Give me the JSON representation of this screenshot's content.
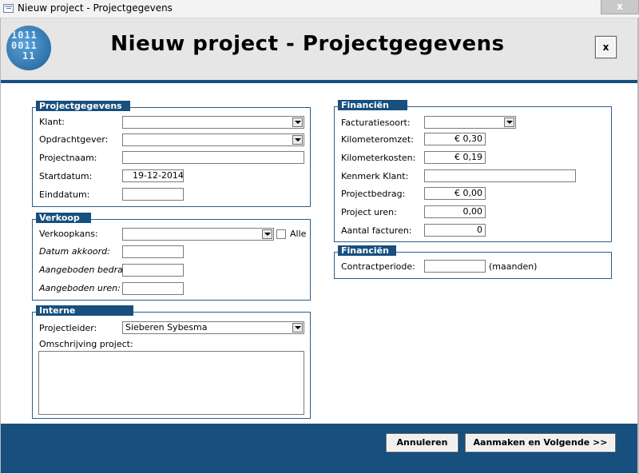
{
  "window": {
    "title": "Nieuw project - Projectgegevens",
    "close_glyph": "x"
  },
  "header": {
    "title": "Nieuw project - Projectgegevens",
    "close_label": "x",
    "logo_bits": [
      "1011",
      "0011",
      "11"
    ]
  },
  "projectgegevens": {
    "title": "Projectgegevens",
    "klant_label": "Klant:",
    "klant_value": "",
    "opdrachtgever_label": "Opdrachtgever:",
    "opdrachtgever_value": "",
    "projectnaam_label": "Projectnaam:",
    "projectnaam_value": "",
    "startdatum_label": "Startdatum:",
    "startdatum_value": "19-12-2014",
    "einddatum_label": "Einddatum:",
    "einddatum_value": ""
  },
  "verkoop": {
    "title": "Verkoop",
    "verkoopkans_label": "Verkoopkans:",
    "verkoopkans_value": "",
    "alle_label": "Alle",
    "datum_akkoord_label": "Datum akkoord:",
    "datum_akkoord_value": "",
    "aangeboden_bedrag_label": "Aangeboden bedra",
    "aangeboden_bedrag_value": "",
    "aangeboden_uren_label": "Aangeboden uren:",
    "aangeboden_uren_value": ""
  },
  "interne_organisatie": {
    "title": "Interne organisatie",
    "projectleider_label": "Projectleider:",
    "projectleider_value": "Sieberen Sybesma",
    "omschrijving_label": "Omschrijving project:",
    "omschrijving_value": ""
  },
  "financien": {
    "title": "Financiën",
    "facturatiesoort_label": "Facturatiesoort:",
    "facturatiesoort_value": "",
    "kilometeromzet_label": "Kilometeromzet:",
    "kilometeromzet_value": "€ 0,30",
    "kilometerkosten_label": "Kilometerkosten:",
    "kilometerkosten_value": "€ 0,19",
    "kenmerk_klant_label": "Kenmerk Klant:",
    "kenmerk_klant_value": "",
    "projectbedrag_label": "Projectbedrag:",
    "projectbedrag_value": "€ 0,00",
    "project_uren_label": "Project uren:",
    "project_uren_value": "0,00",
    "aantal_facturen_label": "Aantal facturen:",
    "aantal_facturen_value": "0"
  },
  "financien2": {
    "title": "Financiën",
    "contractperiode_label": "Contractperiode:",
    "contractperiode_value": "",
    "maanden_label": "(maanden)"
  },
  "footer": {
    "cancel_label": "Annuleren",
    "create_next_label": "Aanmaken en Volgende >>"
  },
  "colors": {
    "accent": "#174f7e",
    "header_bg": "#e6e6e6"
  }
}
